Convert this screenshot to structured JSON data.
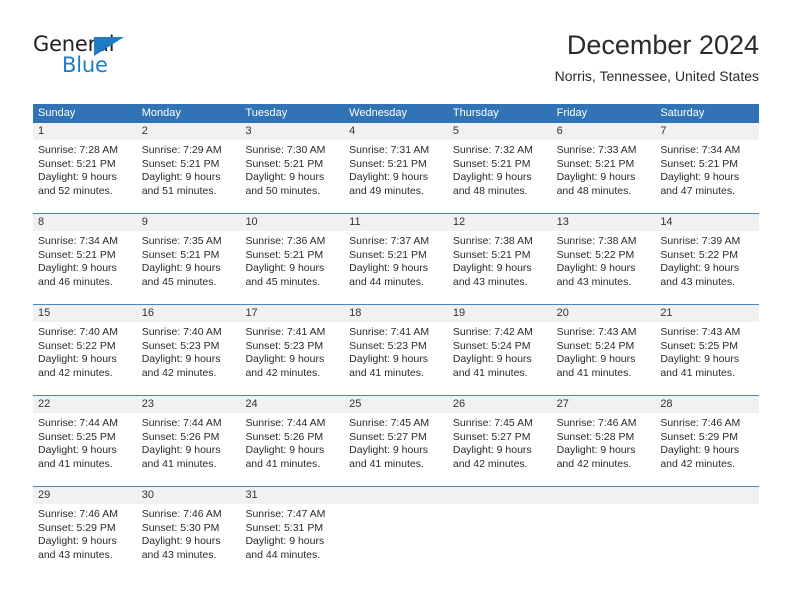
{
  "brand": {
    "name_top": "General",
    "name_bottom": "Blue",
    "accent_color": "#1d7cc4"
  },
  "header": {
    "title": "December 2024",
    "subtitle": "Norris, Tennessee, United States"
  },
  "theme": {
    "header_blue": "#3273b5",
    "day_number_bg": "#f1f1f1",
    "separator_blue": "#4a87c0"
  },
  "calendar": {
    "weekdays": [
      "Sunday",
      "Monday",
      "Tuesday",
      "Wednesday",
      "Thursday",
      "Friday",
      "Saturday"
    ],
    "weeks": [
      [
        {
          "day": "1",
          "lines": [
            "Sunrise: 7:28 AM",
            "Sunset: 5:21 PM",
            "Daylight: 9 hours",
            "and 52 minutes."
          ]
        },
        {
          "day": "2",
          "lines": [
            "Sunrise: 7:29 AM",
            "Sunset: 5:21 PM",
            "Daylight: 9 hours",
            "and 51 minutes."
          ]
        },
        {
          "day": "3",
          "lines": [
            "Sunrise: 7:30 AM",
            "Sunset: 5:21 PM",
            "Daylight: 9 hours",
            "and 50 minutes."
          ]
        },
        {
          "day": "4",
          "lines": [
            "Sunrise: 7:31 AM",
            "Sunset: 5:21 PM",
            "Daylight: 9 hours",
            "and 49 minutes."
          ]
        },
        {
          "day": "5",
          "lines": [
            "Sunrise: 7:32 AM",
            "Sunset: 5:21 PM",
            "Daylight: 9 hours",
            "and 48 minutes."
          ]
        },
        {
          "day": "6",
          "lines": [
            "Sunrise: 7:33 AM",
            "Sunset: 5:21 PM",
            "Daylight: 9 hours",
            "and 48 minutes."
          ]
        },
        {
          "day": "7",
          "lines": [
            "Sunrise: 7:34 AM",
            "Sunset: 5:21 PM",
            "Daylight: 9 hours",
            "and 47 minutes."
          ]
        }
      ],
      [
        {
          "day": "8",
          "lines": [
            "Sunrise: 7:34 AM",
            "Sunset: 5:21 PM",
            "Daylight: 9 hours",
            "and 46 minutes."
          ]
        },
        {
          "day": "9",
          "lines": [
            "Sunrise: 7:35 AM",
            "Sunset: 5:21 PM",
            "Daylight: 9 hours",
            "and 45 minutes."
          ]
        },
        {
          "day": "10",
          "lines": [
            "Sunrise: 7:36 AM",
            "Sunset: 5:21 PM",
            "Daylight: 9 hours",
            "and 45 minutes."
          ]
        },
        {
          "day": "11",
          "lines": [
            "Sunrise: 7:37 AM",
            "Sunset: 5:21 PM",
            "Daylight: 9 hours",
            "and 44 minutes."
          ]
        },
        {
          "day": "12",
          "lines": [
            "Sunrise: 7:38 AM",
            "Sunset: 5:21 PM",
            "Daylight: 9 hours",
            "and 43 minutes."
          ]
        },
        {
          "day": "13",
          "lines": [
            "Sunrise: 7:38 AM",
            "Sunset: 5:22 PM",
            "Daylight: 9 hours",
            "and 43 minutes."
          ]
        },
        {
          "day": "14",
          "lines": [
            "Sunrise: 7:39 AM",
            "Sunset: 5:22 PM",
            "Daylight: 9 hours",
            "and 43 minutes."
          ]
        }
      ],
      [
        {
          "day": "15",
          "lines": [
            "Sunrise: 7:40 AM",
            "Sunset: 5:22 PM",
            "Daylight: 9 hours",
            "and 42 minutes."
          ]
        },
        {
          "day": "16",
          "lines": [
            "Sunrise: 7:40 AM",
            "Sunset: 5:23 PM",
            "Daylight: 9 hours",
            "and 42 minutes."
          ]
        },
        {
          "day": "17",
          "lines": [
            "Sunrise: 7:41 AM",
            "Sunset: 5:23 PM",
            "Daylight: 9 hours",
            "and 42 minutes."
          ]
        },
        {
          "day": "18",
          "lines": [
            "Sunrise: 7:41 AM",
            "Sunset: 5:23 PM",
            "Daylight: 9 hours",
            "and 41 minutes."
          ]
        },
        {
          "day": "19",
          "lines": [
            "Sunrise: 7:42 AM",
            "Sunset: 5:24 PM",
            "Daylight: 9 hours",
            "and 41 minutes."
          ]
        },
        {
          "day": "20",
          "lines": [
            "Sunrise: 7:43 AM",
            "Sunset: 5:24 PM",
            "Daylight: 9 hours",
            "and 41 minutes."
          ]
        },
        {
          "day": "21",
          "lines": [
            "Sunrise: 7:43 AM",
            "Sunset: 5:25 PM",
            "Daylight: 9 hours",
            "and 41 minutes."
          ]
        }
      ],
      [
        {
          "day": "22",
          "lines": [
            "Sunrise: 7:44 AM",
            "Sunset: 5:25 PM",
            "Daylight: 9 hours",
            "and 41 minutes."
          ]
        },
        {
          "day": "23",
          "lines": [
            "Sunrise: 7:44 AM",
            "Sunset: 5:26 PM",
            "Daylight: 9 hours",
            "and 41 minutes."
          ]
        },
        {
          "day": "24",
          "lines": [
            "Sunrise: 7:44 AM",
            "Sunset: 5:26 PM",
            "Daylight: 9 hours",
            "and 41 minutes."
          ]
        },
        {
          "day": "25",
          "lines": [
            "Sunrise: 7:45 AM",
            "Sunset: 5:27 PM",
            "Daylight: 9 hours",
            "and 41 minutes."
          ]
        },
        {
          "day": "26",
          "lines": [
            "Sunrise: 7:45 AM",
            "Sunset: 5:27 PM",
            "Daylight: 9 hours",
            "and 42 minutes."
          ]
        },
        {
          "day": "27",
          "lines": [
            "Sunrise: 7:46 AM",
            "Sunset: 5:28 PM",
            "Daylight: 9 hours",
            "and 42 minutes."
          ]
        },
        {
          "day": "28",
          "lines": [
            "Sunrise: 7:46 AM",
            "Sunset: 5:29 PM",
            "Daylight: 9 hours",
            "and 42 minutes."
          ]
        }
      ],
      [
        {
          "day": "29",
          "lines": [
            "Sunrise: 7:46 AM",
            "Sunset: 5:29 PM",
            "Daylight: 9 hours",
            "and 43 minutes."
          ]
        },
        {
          "day": "30",
          "lines": [
            "Sunrise: 7:46 AM",
            "Sunset: 5:30 PM",
            "Daylight: 9 hours",
            "and 43 minutes."
          ]
        },
        {
          "day": "31",
          "lines": [
            "Sunrise: 7:47 AM",
            "Sunset: 5:31 PM",
            "Daylight: 9 hours",
            "and 44 minutes."
          ]
        },
        {
          "day": "",
          "lines": []
        },
        {
          "day": "",
          "lines": []
        },
        {
          "day": "",
          "lines": []
        },
        {
          "day": "",
          "lines": []
        }
      ]
    ]
  }
}
